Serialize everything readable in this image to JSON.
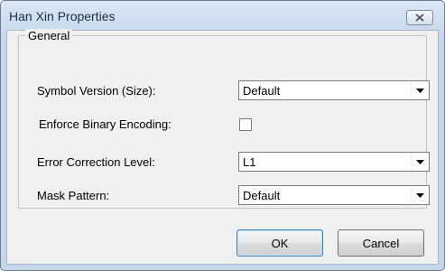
{
  "window": {
    "title": "Han Xin Properties",
    "close_icon": "close-x-icon"
  },
  "group": {
    "legend": "General"
  },
  "fields": {
    "symbol_version_label": "Symbol Version (Size):",
    "symbol_version_value": "Default",
    "enforce_binary_label": "Enforce Binary Encoding:",
    "enforce_binary_checked": false,
    "error_correction_label": "Error Correction Level:",
    "error_correction_value": "L1",
    "mask_pattern_label": "Mask Pattern:",
    "mask_pattern_value": "Default"
  },
  "buttons": {
    "ok": "OK",
    "cancel": "Cancel"
  },
  "colors": {
    "titlebar": "#c6d7ec",
    "client": "#f0f0f0",
    "default_button_border": "#3c7fb1"
  }
}
